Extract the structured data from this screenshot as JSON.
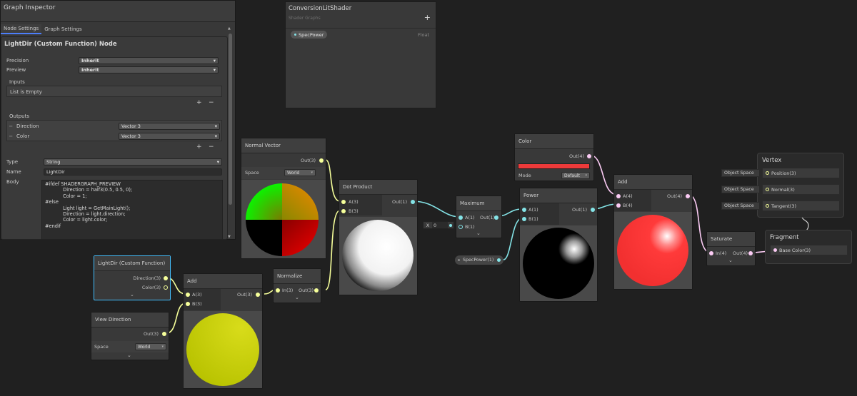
{
  "inspector": {
    "title": "Graph Inspector",
    "tabs": [
      "Node Settings",
      "Graph Settings"
    ],
    "node_title": "LightDir (Custom Function) Node",
    "precision_label": "Precision",
    "precision_value": "Inherit",
    "preview_label": "Preview",
    "preview_value": "Inherit",
    "inputs_label": "Inputs",
    "inputs_empty": "List is Empty",
    "outputs_label": "Outputs",
    "outputs": [
      {
        "name": "Direction",
        "type": "Vector 3"
      },
      {
        "name": "Color",
        "type": "Vector 3"
      }
    ],
    "plus": "+",
    "minus": "−",
    "type_label": "Type",
    "type_value": "String",
    "name_label": "Name",
    "name_value": "LightDir",
    "body_label": "Body",
    "body_code": "#ifdef SHADERGRAPH_PREVIEW\n            Direction = half3(0.5, 0.5, 0);\n            Color = 1;\n#else\n            Light light = GetMainLight();\n            Direction = light.direction;\n            Color = light.color;\n#endif"
  },
  "blackboard": {
    "title": "ConversionLitShader",
    "subtitle": "Shader Graphs",
    "add": "+",
    "property_name": "SpecPower",
    "property_type": "Float"
  },
  "nodes": {
    "normal_vector": {
      "title": "Normal Vector",
      "out": "Out(3)",
      "space_label": "Space",
      "space_value": "World"
    },
    "dot_product": {
      "title": "Dot Product",
      "a": "A(3)",
      "b": "B(3)",
      "out": "Out(1)"
    },
    "maximum": {
      "title": "Maximum",
      "a": "A(1)",
      "b": "B(1)",
      "out": "Out(1)",
      "x_label": "X",
      "x_value": "0"
    },
    "color": {
      "title": "Color",
      "out": "Out(4)",
      "mode_label": "Mode",
      "mode_value": "Default",
      "swatch": "#ee3a3a"
    },
    "power": {
      "title": "Power",
      "a": "A(1)",
      "b": "B(1)",
      "out": "Out(1)"
    },
    "spec_power": {
      "label": "SpecPower(1)"
    },
    "add_top": {
      "title": "Add",
      "a": "A(4)",
      "b": "B(4)",
      "out": "Out(4)"
    },
    "saturate": {
      "title": "Saturate",
      "in": "In(4)",
      "out": "Out(4)"
    },
    "custom_function": {
      "title": "LightDir (Custom Function)",
      "direction": "Direction(3)",
      "color": "Color(3)"
    },
    "view_direction": {
      "title": "View Direction",
      "out": "Out(3)",
      "space_label": "Space",
      "space_value": "World"
    },
    "add_bottom": {
      "title": "Add",
      "a": "A(3)",
      "b": "B(3)",
      "out": "Out(3)"
    },
    "normalize": {
      "title": "Normalize",
      "in": "In(3)",
      "out": "Out(3)"
    }
  },
  "vertex": {
    "title": "Vertex",
    "blocks": [
      {
        "label": "Position(3)",
        "space": "Object Space"
      },
      {
        "label": "Normal(3)",
        "space": "Object Space"
      },
      {
        "label": "Tangent(3)",
        "space": "Object Space"
      }
    ]
  },
  "fragment": {
    "title": "Fragment",
    "blocks": [
      {
        "label": "Base Color(3)"
      }
    ]
  },
  "colors": {
    "vec1": "#84e4e7",
    "vec3": "#f6ff9a",
    "vec4": "#fbcbf4",
    "selected": "#44c0ff"
  }
}
